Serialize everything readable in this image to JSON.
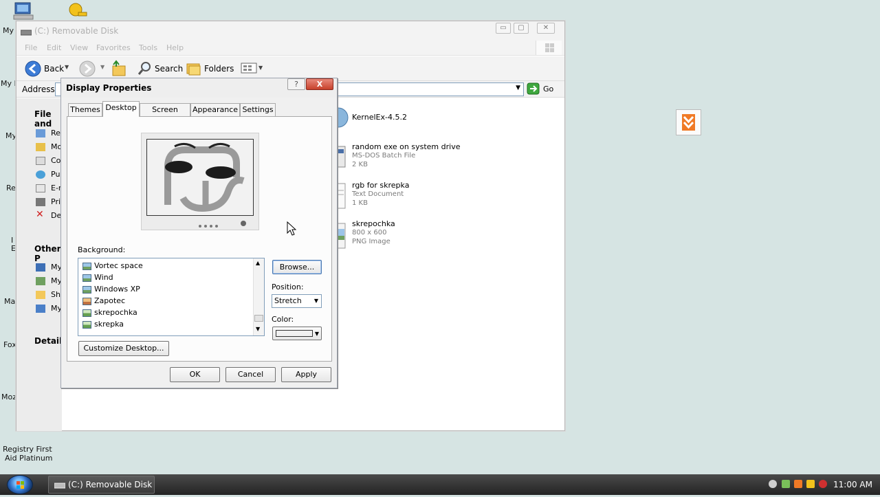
{
  "desktop": {
    "labels": [
      "My",
      "My D",
      "My",
      "Re",
      "I",
      "E",
      "Mai",
      "Fox",
      "Moz"
    ],
    "registry_label_1": "Registry First",
    "registry_label_2": "Aid Platinum"
  },
  "explorer": {
    "title": "(C:) Removable Disk",
    "menu": [
      "File",
      "Edit",
      "View",
      "Favorites",
      "Tools",
      "Help"
    ],
    "toolbar": {
      "back": "Back",
      "search": "Search",
      "folders": "Folders"
    },
    "address_label": "Address",
    "go_label": "Go",
    "left_pane": {
      "file_tasks_heading": "File and",
      "file_tasks": [
        "Re",
        "Mo",
        "Co",
        "Pub",
        "E-m",
        "Pri",
        "Del"
      ],
      "other_places_heading": "Other P",
      "other_places": [
        "My",
        "My",
        "Sha",
        "My"
      ],
      "details_heading": "Details"
    },
    "files": [
      {
        "name": "KernelEx-4.5.2",
        "line1": "",
        "line2": ""
      },
      {
        "name": "random exe on system drive",
        "line1": "MS-DOS Batch File",
        "line2": "2 KB"
      },
      {
        "name": "rgb for skrepka",
        "line1": "Text Document",
        "line2": "1 KB"
      },
      {
        "name": "skrepochka",
        "line1": "800 x 600",
        "line2": "PNG Image"
      }
    ]
  },
  "dialog": {
    "title": "Display Properties",
    "help": "?",
    "close": "X",
    "tabs": [
      "Themes",
      "Desktop",
      "Screen Saver",
      "Appearance",
      "Settings"
    ],
    "active_tab": "Desktop",
    "background_label": "Background:",
    "backgrounds": [
      "Vortec space",
      "Wind",
      "Windows XP",
      "Zapotec",
      "skrepochka",
      "skrepka"
    ],
    "browse": "Browse...",
    "position_label": "Position:",
    "position_value": "Stretch",
    "color_label": "Color:",
    "color_value": "#f0f0f0",
    "customize": "Customize Desktop...",
    "ok": "OK",
    "cancel": "Cancel",
    "apply": "Apply"
  },
  "taskbar": {
    "task": "(C:) Removable Disk",
    "clock": "11:00 AM"
  }
}
